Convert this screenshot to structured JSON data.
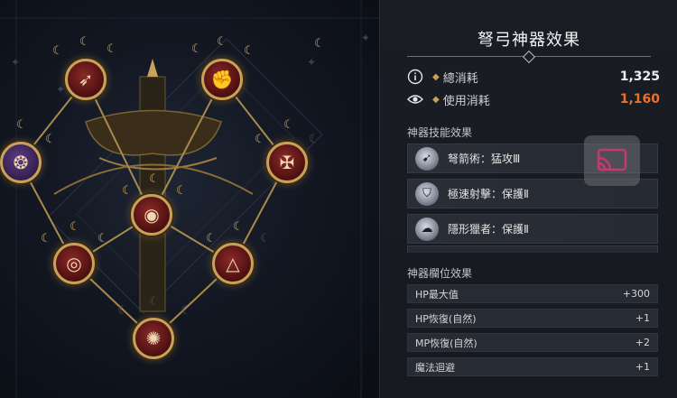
{
  "panel": {
    "title": "弩弓神器效果",
    "total_cost": {
      "label": "總消耗",
      "value": "1,325"
    },
    "used_cost": {
      "label": "使用消耗",
      "value": "1,160",
      "color": "#e8722c"
    },
    "skills_header": "神器技能效果",
    "skills": [
      {
        "label": "弩箭術：猛攻Ⅲ",
        "icon": "archer-skill-icon"
      },
      {
        "label": "極速射擊：保護Ⅱ",
        "icon": "helmet-skill-icon"
      },
      {
        "label": "隱形獵者：保護Ⅱ",
        "icon": "stealth-skill-icon"
      }
    ],
    "slots_header": "神器欄位效果",
    "slots": [
      {
        "label": "HP最大值",
        "value": "+300"
      },
      {
        "label": "HP恢復(自然)",
        "value": "+1"
      },
      {
        "label": "MP恢復(自然)",
        "value": "+2"
      },
      {
        "label": "魔法迴避",
        "value": "+1"
      }
    ]
  },
  "tree": {
    "nodes": [
      {
        "name": "node-top-left",
        "icon": "bow-emblem-icon",
        "style": "red"
      },
      {
        "name": "node-top-right",
        "icon": "fist-icon",
        "style": "red"
      },
      {
        "name": "node-left",
        "icon": "spirit-icon",
        "style": "purple"
      },
      {
        "name": "node-right",
        "icon": "cross-emblem-icon",
        "style": "red"
      },
      {
        "name": "node-center",
        "icon": "eye-icon",
        "style": "red"
      },
      {
        "name": "node-lower-left",
        "icon": "vortex-icon",
        "style": "red"
      },
      {
        "name": "node-lower-right",
        "icon": "triangle-rune-icon",
        "style": "red"
      },
      {
        "name": "node-bottom",
        "icon": "arrow-burst-icon",
        "style": "red"
      }
    ]
  },
  "colors": {
    "gold": "#c9a25a",
    "accent_orange": "#e8722c"
  },
  "cast_button": {
    "icon": "cast-screen-icon"
  }
}
